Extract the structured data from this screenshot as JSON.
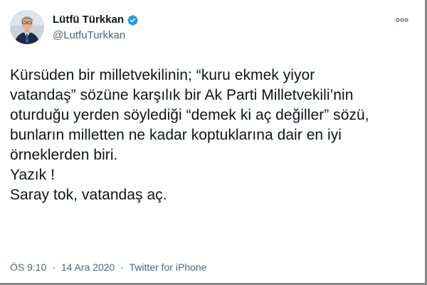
{
  "author": {
    "display_name": "Lütfü Türkkan",
    "handle": "@LutfuTurkkan",
    "verified": true,
    "avatar_icon": "profile-photo-icon"
  },
  "more_icon": "ellipsis-icon",
  "tweet": {
    "lines": [
      "Kürsüden bir milletvekilinin; “kuru ekmek yiyor",
      "vatandaş” sözüne karşılık bir Ak Parti Milletvekili’nin",
      "oturduğu yerden söylediği “demek ki aç değiller” sözü,",
      "bunların milletten ne kadar koptuklarına dair en iyi",
      "örneklerden biri.",
      "Yazık !",
      "Saray tok, vatandaş aç."
    ]
  },
  "meta": {
    "time": "ÖS 9:10",
    "separator": "·",
    "date": "14 Ara 2020",
    "source": "Twitter for iPhone"
  },
  "colors": {
    "text": "#0f1419",
    "secondary": "#536471",
    "verified": "#1d9bf0"
  }
}
